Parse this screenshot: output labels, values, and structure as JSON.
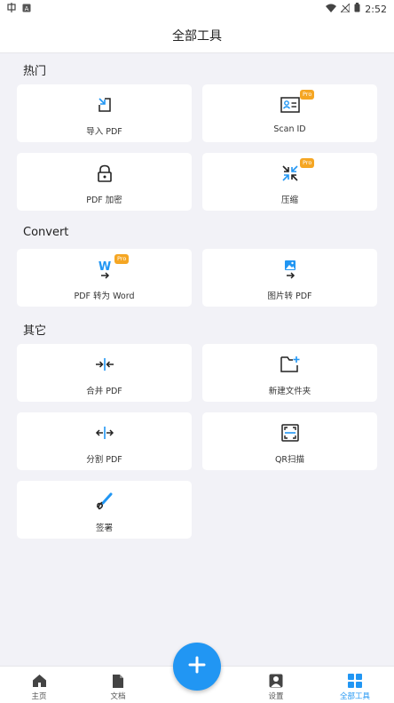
{
  "status": {
    "time": "2:52"
  },
  "header": {
    "title": "全部工具"
  },
  "sections": [
    {
      "title": "热门"
    },
    {
      "title": "Convert"
    },
    {
      "title": "其它"
    }
  ],
  "tools": {
    "import_pdf": {
      "label": "导入 PDF",
      "icon": "import-icon"
    },
    "scan_id": {
      "label": "Scan ID",
      "icon": "id-card-icon",
      "badge": "Pro"
    },
    "pdf_encrypt": {
      "label": "PDF 加密",
      "icon": "lock-icon"
    },
    "compress": {
      "label": "压缩",
      "icon": "compress-icon",
      "badge": "Pro"
    },
    "pdf_to_word": {
      "label": "PDF 转为 Word",
      "icon": "word-icon",
      "badge": "Pro",
      "glyph": "W"
    },
    "image_to_pdf": {
      "label": "图片转 PDF",
      "icon": "image-icon"
    },
    "merge_pdf": {
      "label": "合并 PDF",
      "icon": "merge-icon"
    },
    "new_folder": {
      "label": "新建文件夹",
      "icon": "new-folder-icon"
    },
    "split_pdf": {
      "label": "分割 PDF",
      "icon": "split-icon"
    },
    "qr_scan": {
      "label": "QR扫描",
      "icon": "qr-scan-icon"
    },
    "signature": {
      "label": "签署",
      "icon": "signature-icon"
    }
  },
  "nav": {
    "home": "主页",
    "docs": "文档",
    "settings": "设置",
    "all_tools": "全部工具"
  },
  "colors": {
    "accent": "#2196f3",
    "pro": "#f5a623"
  }
}
